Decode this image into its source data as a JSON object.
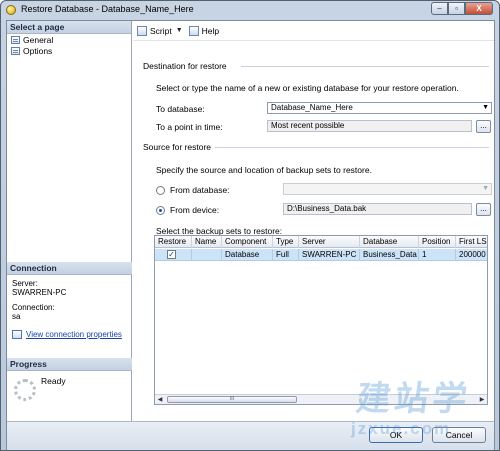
{
  "window": {
    "title": "Restore Database - Database_Name_Here",
    "controls": {
      "minimize": "–",
      "restore": "▫",
      "close": "X"
    }
  },
  "left_panel": {
    "select_page_header": "Select a page",
    "pages": [
      {
        "label": "General",
        "icon": "page-icon"
      },
      {
        "label": "Options",
        "icon": "page-icon"
      }
    ],
    "connection_header": "Connection",
    "server_label": "Server:",
    "server_value": "SWARREN-PC",
    "connection_label": "Connection:",
    "connection_value": "sa",
    "view_connection_link": "View connection properties",
    "progress_header": "Progress",
    "progress_status": "Ready"
  },
  "toolbar": {
    "script_label": "Script",
    "help_label": "Help"
  },
  "destination": {
    "header": "Destination for restore",
    "description": "Select or type the name of a new or existing database for your restore operation.",
    "to_database_label": "To database:",
    "to_database_value": "Database_Name_Here",
    "point_in_time_label": "To a point in time:",
    "point_in_time_value": "Most recent possible",
    "browse": "..."
  },
  "source": {
    "header": "Source for restore",
    "description": "Specify the source and location of backup sets to restore.",
    "from_database_label": "From database:",
    "from_database_value": "",
    "from_device_label": "From device:",
    "from_device_value": "D:\\Business_Data.bak",
    "browse": "...",
    "select_backup_sets_label": "Select the backup sets to restore:"
  },
  "backup_grid": {
    "columns": [
      "Restore",
      "Name",
      "Component",
      "Type",
      "Server",
      "Database",
      "Position",
      "First LSN"
    ],
    "rows": [
      {
        "restore": "✓",
        "name": "",
        "component": "Database",
        "type": "Full",
        "server": "SWARREN-PC",
        "database": "Business_Data",
        "position": "1",
        "first_lsn": "200000"
      }
    ],
    "scroll_left": "◀",
    "scroll_right": "▶",
    "thumb_grip": "III"
  },
  "buttons": {
    "ok": "OK",
    "cancel": "Cancel"
  },
  "watermark": {
    "large": "建站学",
    "small": "jzxue.com"
  }
}
